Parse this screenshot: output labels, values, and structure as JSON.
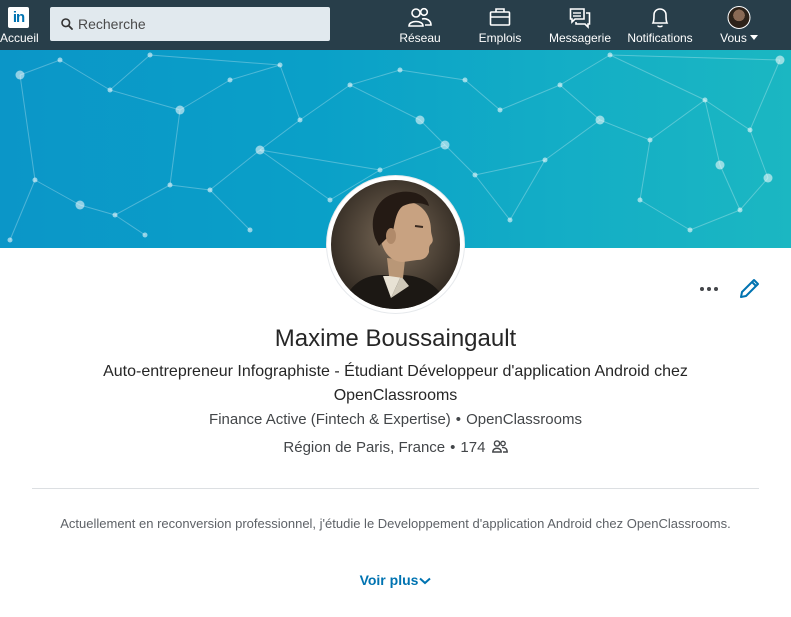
{
  "nav": {
    "logo_text": "in",
    "home_label": "Accueil",
    "search_placeholder": "Recherche",
    "items": [
      {
        "label": "Réseau",
        "icon": "people-icon"
      },
      {
        "label": "Emplois",
        "icon": "briefcase-icon"
      },
      {
        "label": "Messagerie",
        "icon": "chat-icon"
      },
      {
        "label": "Notifications",
        "icon": "bell-icon"
      },
      {
        "label": "Vous",
        "icon": "avatar"
      }
    ]
  },
  "profile": {
    "name": "Maxime Boussaingault",
    "headline": "Auto-entrepreneur Infographiste - Étudiant Développeur d'application Android chez OpenClassrooms",
    "company": "Finance Active (Fintech & Expertise)",
    "school": "OpenClassrooms",
    "location": "Région de Paris, France",
    "connections": "174",
    "summary": "Actuellement en reconversion professionnel, j'étudie le Developpement d'application Android chez OpenClassrooms.",
    "see_more_label": "Voir plus"
  },
  "colors": {
    "nav_bg": "#283e4a",
    "brand": "#0073b1",
    "banner_start": "#0b96c8",
    "banner_end": "#1bb7c2"
  }
}
